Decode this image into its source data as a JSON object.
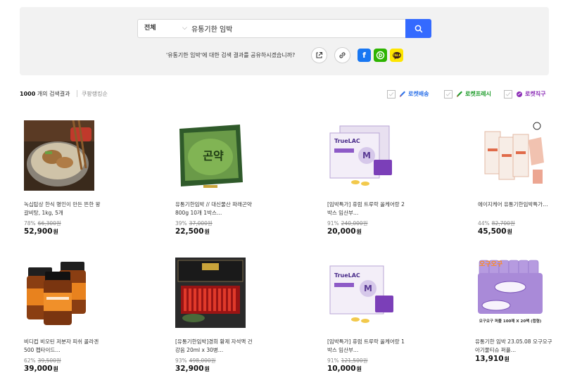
{
  "search": {
    "category": "전체",
    "query": "유통기한 임박",
    "share_text": "'유통기한 임박'에 대한 검색 결과를 공유하시겠습니까?"
  },
  "results": {
    "count": "1000",
    "count_suffix": "개의 검색결과",
    "ranking_label": "쿠팡랭킹순",
    "filters": [
      {
        "label": "로켓배송",
        "color": "#2f73e9"
      },
      {
        "label": "로켓프레시",
        "color": "#1d9b29"
      },
      {
        "label": "로켓직구",
        "color": "#8d2fb7"
      }
    ]
  },
  "products": [
    {
      "name": "녹십탑상 한식 명인이 만든 뜬한 왕 갈비탕, 1kg, 5개",
      "discount": "78%",
      "original_price": "66,300원",
      "price": "52,900",
      "image": "soup-bowl"
    },
    {
      "name": "유통기한임박 // 대신물산 파래곤약 800g 10개 1박스…",
      "discount": "39%",
      "original_price": "37,000원",
      "price": "22,500",
      "image": "konjac-bag"
    },
    {
      "name": "[임박특가] 휴럼 트루락 올케어랑 2박스 임산부…",
      "discount": "91%",
      "original_price": "240,000원",
      "price": "20,000",
      "image": "truelac-box-2"
    },
    {
      "name": "에이지케어 유통기한임박특가…",
      "discount": "44%",
      "original_price": "82,700원",
      "price": "45,500",
      "image": "diet-pouch"
    },
    {
      "name": "비디컵 비오틴 저분자 피쉬 콜라겐 500 펩타이드…",
      "discount": "62%",
      "original_price": "39,500원",
      "price": "39,000",
      "image": "supplement-bottles"
    },
    {
      "name": "[유통기한임박]경희 황제 자석액 건강음 20ml x 30병…",
      "discount": "93%",
      "original_price": "498,000원",
      "price": "32,900",
      "image": "red-gift-box"
    },
    {
      "name": "[임박특가] 휴럼 트루락 올케어랑 1박스 임산부…",
      "discount": "91%",
      "original_price": "121,500원",
      "price": "10,000",
      "image": "truelac-box-1"
    },
    {
      "name": "유통기한 임박 23.05.08 오구오구 아기물티슈 퍼플…",
      "discount": "",
      "original_price": "",
      "price": "13,910",
      "image": "wet-tissue",
      "image_text": {
        "logo": "오구오구",
        "caption": "오구오구 퍼플 100매 X 20팩 (캡형)"
      }
    }
  ]
}
